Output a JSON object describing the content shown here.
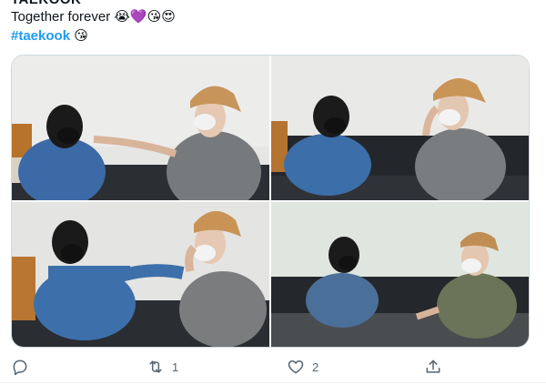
{
  "tweet": {
    "author_partial": "TAEKOOK",
    "line1_text": "Together forever ",
    "line1_emojis": "😭💜😘😍",
    "hashtag": "#taekook",
    "line2_emoji": "😘"
  },
  "media": {
    "photos": [
      {
        "name": "photo-1"
      },
      {
        "name": "photo-2"
      },
      {
        "name": "photo-3"
      },
      {
        "name": "photo-4"
      }
    ]
  },
  "actions": {
    "reply": {
      "icon": "reply-icon",
      "count": ""
    },
    "retweet": {
      "icon": "retweet-icon",
      "count": "1"
    },
    "like": {
      "icon": "heart-icon",
      "count": "2"
    },
    "share": {
      "icon": "share-icon",
      "count": ""
    }
  },
  "colors": {
    "hashtag": "#1d9bf0",
    "icon_gray": "#536471",
    "border": "#cfd9de"
  }
}
